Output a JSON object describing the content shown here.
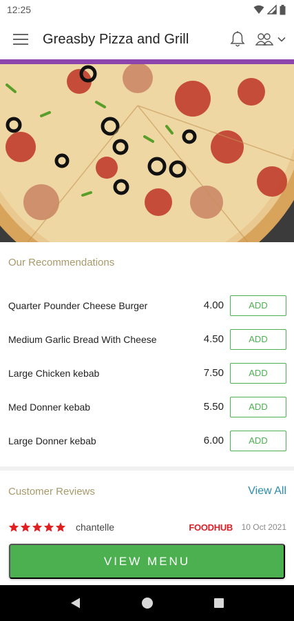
{
  "status_bar": {
    "time": "12:25"
  },
  "header": {
    "title": "Greasby Pizza and Grill"
  },
  "colors": {
    "accent": "#8e44ad",
    "primary_green": "#4cb050",
    "heading_gold": "#a89a6a",
    "link_blue": "#2a8bb0",
    "star_red": "#e02020",
    "foodhub_red": "#d81f26"
  },
  "hero": {
    "image": "pizza-photo"
  },
  "recommendations": {
    "heading": "Our Recommendations",
    "add_label": "ADD",
    "items": [
      {
        "name": "Quarter Pounder Cheese Burger",
        "price": "4.00"
      },
      {
        "name": "Medium Garlic Bread With Cheese",
        "price": "4.50"
      },
      {
        "name": "Large Chicken kebab",
        "price": "7.50"
      },
      {
        "name": "Med Donner kebab",
        "price": "5.50"
      },
      {
        "name": "Large Donner kebab",
        "price": "6.00"
      }
    ]
  },
  "reviews": {
    "heading": "Customer Reviews",
    "view_all": "View All",
    "items": [
      {
        "rating": 5,
        "reviewer": "chantelle",
        "source": "FOODHUB",
        "date": "10 Oct 2021"
      }
    ]
  },
  "cta": {
    "label": "VIEW MENU"
  },
  "icons": [
    "menu-icon",
    "bell-icon",
    "user-switch-icon",
    "chevron-down-icon",
    "wifi-icon",
    "signal-icon",
    "battery-icon",
    "back-icon",
    "home-icon",
    "recents-icon",
    "star-icon"
  ]
}
